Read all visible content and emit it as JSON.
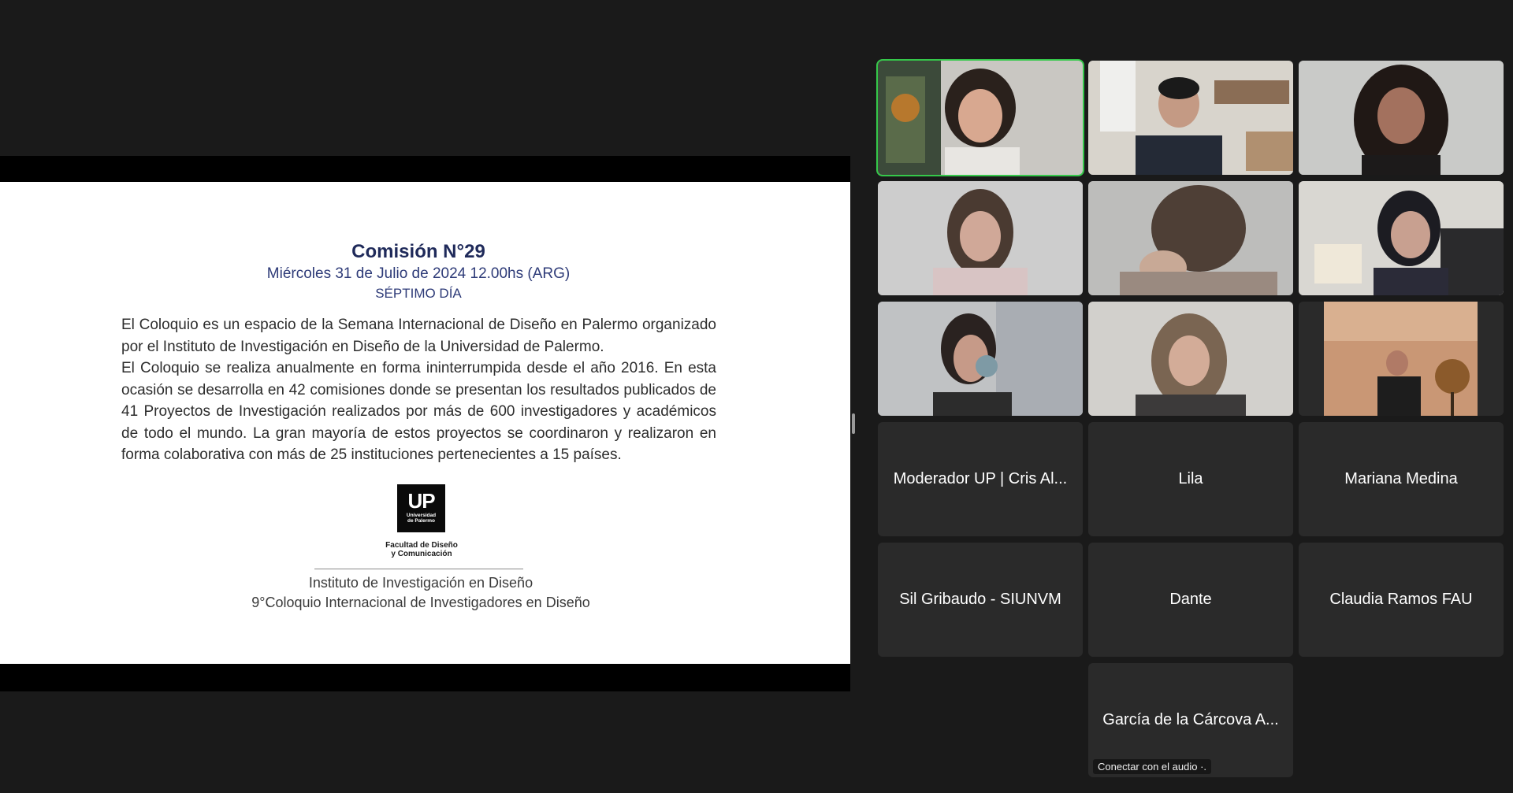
{
  "slide": {
    "title": "Comisión N°29",
    "date": "Miércoles 31 de Julio de 2024 12.00hs (ARG)",
    "day": "SÉPTIMO DÍA",
    "paragraph1": "El Coloquio es un espacio de la Semana Internacional de Diseño en Palermo organizado por el Instituto de Investigación en Diseño de la Universidad de Palermo.",
    "paragraph2": "El Coloquio se realiza anualmente en forma ininterrumpida desde el año 2016. En esta ocasión se desarrolla en 42 comisiones donde se presentan los resultados publicados de 41 Proyectos de Investigación realizados por más de 600 investigadores y académicos de todo el mundo. La gran mayoría de estos proyectos se coordinaron y realizaron en forma colaborativa con más de 25 instituciones pertenecientes a 15 países.",
    "logo_text": "UP",
    "logo_sub1": "Universidad",
    "logo_sub2": "de Palermo",
    "logo_caption1": "Facultad de Diseño",
    "logo_caption2": "y Comunicación",
    "institute": "Instituto de Investigación en Diseño",
    "coloquio": "9°Coloquio Internacional de Investigadores en Diseño"
  },
  "participants": {
    "video_tiles": [
      {
        "id": "p1",
        "active": true
      },
      {
        "id": "p2"
      },
      {
        "id": "p3"
      },
      {
        "id": "p4"
      },
      {
        "id": "p5"
      },
      {
        "id": "p6"
      },
      {
        "id": "p7"
      },
      {
        "id": "p8"
      },
      {
        "id": "p9"
      }
    ],
    "name_tiles": [
      "Moderador UP | Cris Al...",
      "Lila",
      "Mariana Medina",
      "Sil Gribaudo - SIUNVM",
      "Dante",
      "Claudia Ramos FAU",
      "García de la Cárcova A..."
    ],
    "audio_label": "Conectar con el audio ·.",
    "active_speaker_color": "#35c84a"
  }
}
